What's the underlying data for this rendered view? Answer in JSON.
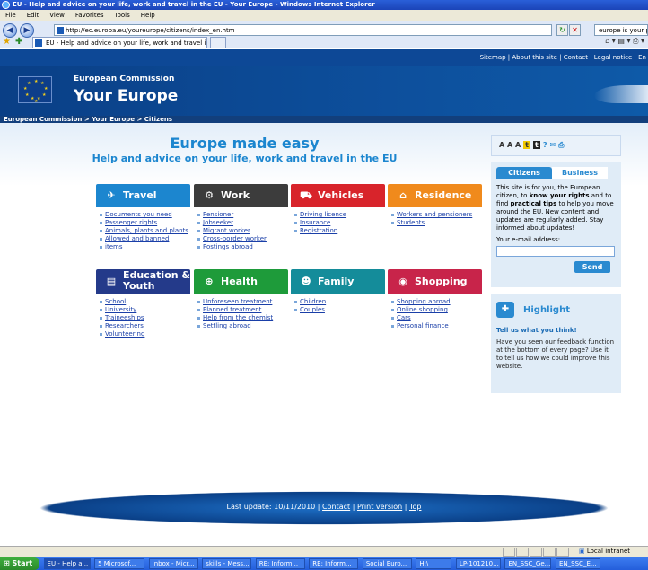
{
  "window": {
    "title": "EU - Help and advice on your life, work and travel in the EU - Your Europe - Windows Internet Explorer"
  },
  "menu": [
    "File",
    "Edit",
    "View",
    "Favorites",
    "Tools",
    "Help"
  ],
  "address": {
    "url": "http://ec.europa.eu/youreurope/citizens/index_en.htm",
    "search": "europe is your playgrou"
  },
  "tab": {
    "label": "EU - Help and advice on your life, work and travel in t..."
  },
  "toplinks": "Sitemap | About this site | Contact | Legal notice | En",
  "header": {
    "ec": "European Commission",
    "ye": "Your Europe"
  },
  "breadcrumb": "European Commission  >  Your Europe  >  Citizens",
  "hero": {
    "title": "Europe made easy",
    "subtitle": "Help and advice on your life, work and travel in the EU"
  },
  "categories": [
    {
      "title": "Travel",
      "links": [
        "Documents you need",
        "Passenger rights",
        "Animals, plants and plants",
        "Allowed and banned",
        "items"
      ]
    },
    {
      "title": "Work",
      "links": [
        "Pensioner",
        "Jobseeker",
        "Migrant worker",
        "Cross-border worker",
        "Postings abroad"
      ]
    },
    {
      "title": "Vehicles",
      "links": [
        "Driving licence",
        "Insurance",
        "Registration"
      ]
    },
    {
      "title": "Residence",
      "links": [
        "Workers and pensioners",
        "Students"
      ]
    },
    {
      "title_line1": "Education &",
      "title_line2": "Youth",
      "links": [
        "School",
        "University",
        "Traineeships",
        "Researchers",
        "Volunteering"
      ]
    },
    {
      "title": "Health",
      "links": [
        "Unforeseen treatment",
        "Planned treatment",
        "Help from the chemist",
        "Settling abroad"
      ]
    },
    {
      "title": "Family",
      "links": [
        "Children",
        "Couples"
      ]
    },
    {
      "title": "Shopping",
      "links": [
        "Shopping abroad",
        "Online shopping",
        "Cars",
        "Personal finance"
      ]
    }
  ],
  "sidebar": {
    "toolbox": "A A A",
    "tabs": [
      "Citizens",
      "Business"
    ],
    "intro_1": "This site is for you, the European citizen, to ",
    "intro_b1": "know your rights",
    "intro_2": " and to find ",
    "intro_b2": "practical tips",
    "intro_3": " to help you move around the EU. New content and updates are regularly added. Stay informed about updates!",
    "email_label": "Your e-mail address:",
    "send": "Send",
    "highlight": {
      "title": "Highlight",
      "subtitle": "Tell us what you think!",
      "text": "Have you seen our feedback function at the bottom of every page? Use it to tell us how we could improve this website."
    }
  },
  "footer": {
    "text": "Last update: 10/11/2010 | ",
    "contact": "Contact",
    "sep": " | ",
    "print": "Print version",
    "sep2": " | ",
    "top": "Top"
  },
  "status": {
    "zone": "Local intranet"
  },
  "taskbar": [
    "EU - Help a...",
    "5 Microsof...",
    "Inbox - Micr...",
    "skills - Mess...",
    "RE: Inform...",
    "RE: Inform...",
    "Social Euro...",
    "H:\\",
    "LP-101210...",
    "EN_SSC_Ge...",
    "EN_SSC_E..."
  ],
  "taskbar_start": "Start",
  "colors": {
    "travel": "#1c86cf",
    "work": "#3c3c3c",
    "vehicles": "#d8242b",
    "residence": "#f08a1c",
    "education": "#243a8a",
    "health": "#1e9b3a",
    "family": "#148c9a",
    "shopping": "#c8244a"
  }
}
